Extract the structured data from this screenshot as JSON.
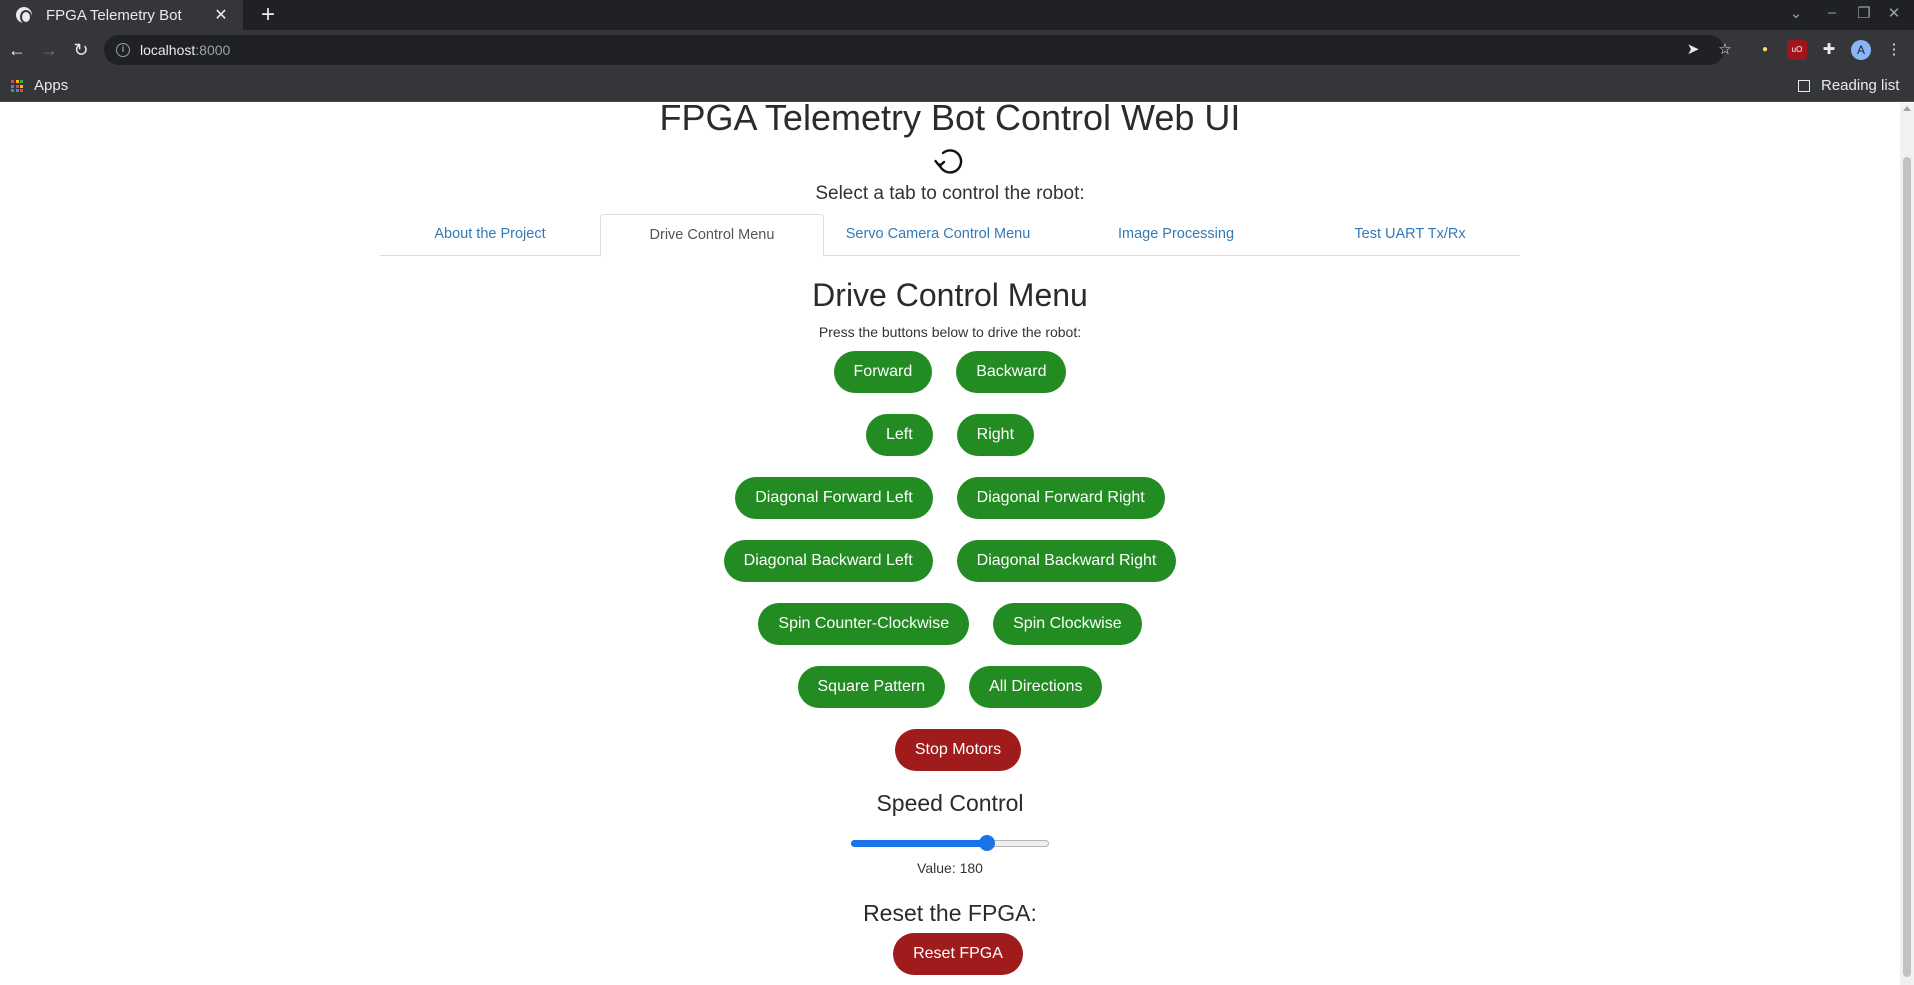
{
  "browser": {
    "tab_title": "FPGA Telemetry Bot",
    "tab_close": "✕",
    "new_tab": "+",
    "url_host": "localhost",
    "url_rest": ":8000",
    "apps_label": "Apps",
    "reading_list_label": "Reading list",
    "avatar_letter": "A",
    "extension_badge": "uO"
  },
  "page": {
    "title": "FPGA Telemetry Bot Control Web UI",
    "subtitle": "Select a tab to control the robot:",
    "tabs": [
      {
        "label": "About the Project",
        "active": false
      },
      {
        "label": "Drive Control Menu",
        "active": true
      },
      {
        "label": "Servo Camera Control Menu",
        "active": false
      },
      {
        "label": "Image Processing",
        "active": false
      },
      {
        "label": "Test UART Tx/Rx",
        "active": false
      }
    ],
    "drive": {
      "title": "Drive Control Menu",
      "description": "Press the buttons below to drive the robot:",
      "buttons": {
        "forward": "Forward",
        "backward": "Backward",
        "left": "Left",
        "right": "Right",
        "diag_fwd_left": "Diagonal Forward Left",
        "diag_fwd_right": "Diagonal Forward Right",
        "diag_bwd_left": "Diagonal Backward Left",
        "diag_bwd_right": "Diagonal Backward Right",
        "spin_ccw": "Spin Counter-Clockwise",
        "spin_cw": "Spin Clockwise",
        "square": "Square Pattern",
        "all_dirs": "All Directions",
        "stop": "Stop Motors"
      }
    },
    "speed": {
      "title": "Speed Control",
      "value_text": "Value: 180",
      "value": 180,
      "min": 0,
      "max": 255
    },
    "reset": {
      "title": "Reset the FPGA:",
      "button": "Reset FPGA"
    }
  },
  "colors": {
    "button_green": "#228b22",
    "button_red": "#a01c1c",
    "link_blue": "#337ab7",
    "slider_blue": "#1a73e8"
  }
}
